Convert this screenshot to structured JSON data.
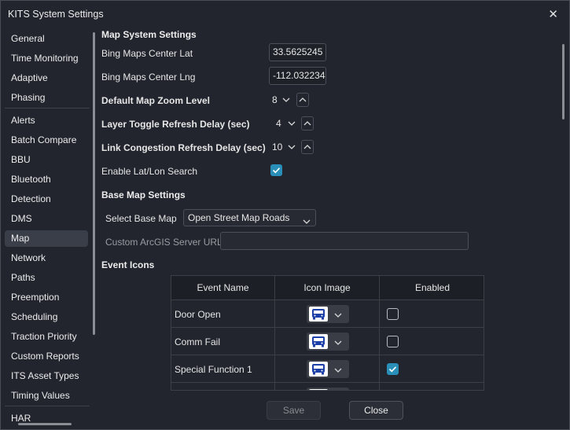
{
  "window": {
    "title": "KITS System Settings",
    "close_glyph": "✕"
  },
  "sidebar": {
    "items": [
      {
        "label": "General"
      },
      {
        "label": "Time Monitoring"
      },
      {
        "label": "Adaptive"
      },
      {
        "label": "Phasing"
      },
      {
        "label": "Alerts"
      },
      {
        "label": "Batch Compare"
      },
      {
        "label": "BBU"
      },
      {
        "label": "Bluetooth"
      },
      {
        "label": "Detection"
      },
      {
        "label": "DMS"
      },
      {
        "label": "Map",
        "selected": true
      },
      {
        "label": "Network"
      },
      {
        "label": "Paths"
      },
      {
        "label": "Preemption"
      },
      {
        "label": "Scheduling"
      },
      {
        "label": "Traction Priority"
      },
      {
        "label": "Custom Reports"
      },
      {
        "label": "ITS Asset Types"
      },
      {
        "label": "Timing Values"
      },
      {
        "label": "HAR"
      }
    ]
  },
  "map_system": {
    "section_title": "Map System Settings",
    "center_lat_label": "Bing Maps Center Lat",
    "center_lat_value": "33.5625245",
    "center_lng_label": "Bing Maps Center Lng",
    "center_lng_value": "-112.032234",
    "zoom_label": "Default Map Zoom Level",
    "zoom_value": "8",
    "layer_refresh_label": "Layer Toggle Refresh Delay (sec)",
    "layer_refresh_value": "4",
    "link_refresh_label": "Link Congestion Refresh Delay (sec)",
    "link_refresh_value": "10",
    "latlon_search_label": "Enable Lat/Lon Search",
    "latlon_search_enabled": true
  },
  "base_map": {
    "section_title": "Base Map Settings",
    "select_label": "Select Base Map",
    "selected_value": "Open Street Map Roads",
    "arcgis_label": "Custom ArcGIS Server URL",
    "arcgis_value": ""
  },
  "event_icons": {
    "section_title": "Event Icons",
    "columns": [
      "Event Name",
      "Icon Image",
      "Enabled"
    ],
    "rows": [
      {
        "name": "Door Open",
        "icon": "bus-icon",
        "enabled": false
      },
      {
        "name": "Comm Fail",
        "icon": "bus-icon",
        "enabled": false
      },
      {
        "name": "Special Function 1",
        "icon": "bus-icon",
        "enabled": true
      },
      {
        "name": "",
        "icon": "alert-icon",
        "enabled": false
      }
    ]
  },
  "footer": {
    "save_label": "Save",
    "close_label": "Close"
  },
  "colors": {
    "accent": "#2a8fb8",
    "icon_blue": "#1c3fa8",
    "background": "#22252e"
  }
}
